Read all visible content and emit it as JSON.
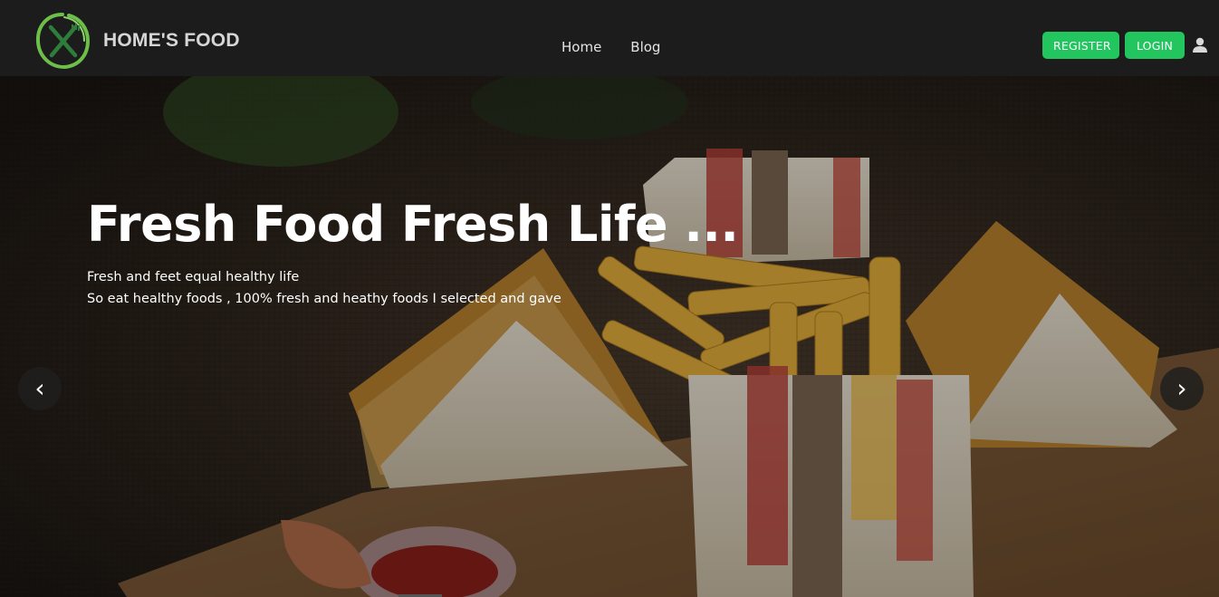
{
  "brand": {
    "name": "HOME'S FOOD",
    "logo_icon": "fork-knife-icon",
    "accent": "#6cc04a"
  },
  "nav": {
    "links": [
      {
        "label": "Home"
      },
      {
        "label": "Blog"
      }
    ]
  },
  "auth": {
    "register_label": "REGISTER",
    "login_label": "LOGIN",
    "user_icon": "user-icon",
    "button_color": "#22c55e"
  },
  "hero": {
    "title": "Fresh Food Fresh Life ...",
    "subtitle_line1": "Fresh and feet equal healthy life",
    "subtitle_line2": "So eat healthy foods , 100% fresh and heathy foods I selected and gave",
    "prev_icon": "chevron-left-icon",
    "next_icon": "chevron-right-icon",
    "prev_symbol": "‹",
    "next_symbol": "›"
  }
}
